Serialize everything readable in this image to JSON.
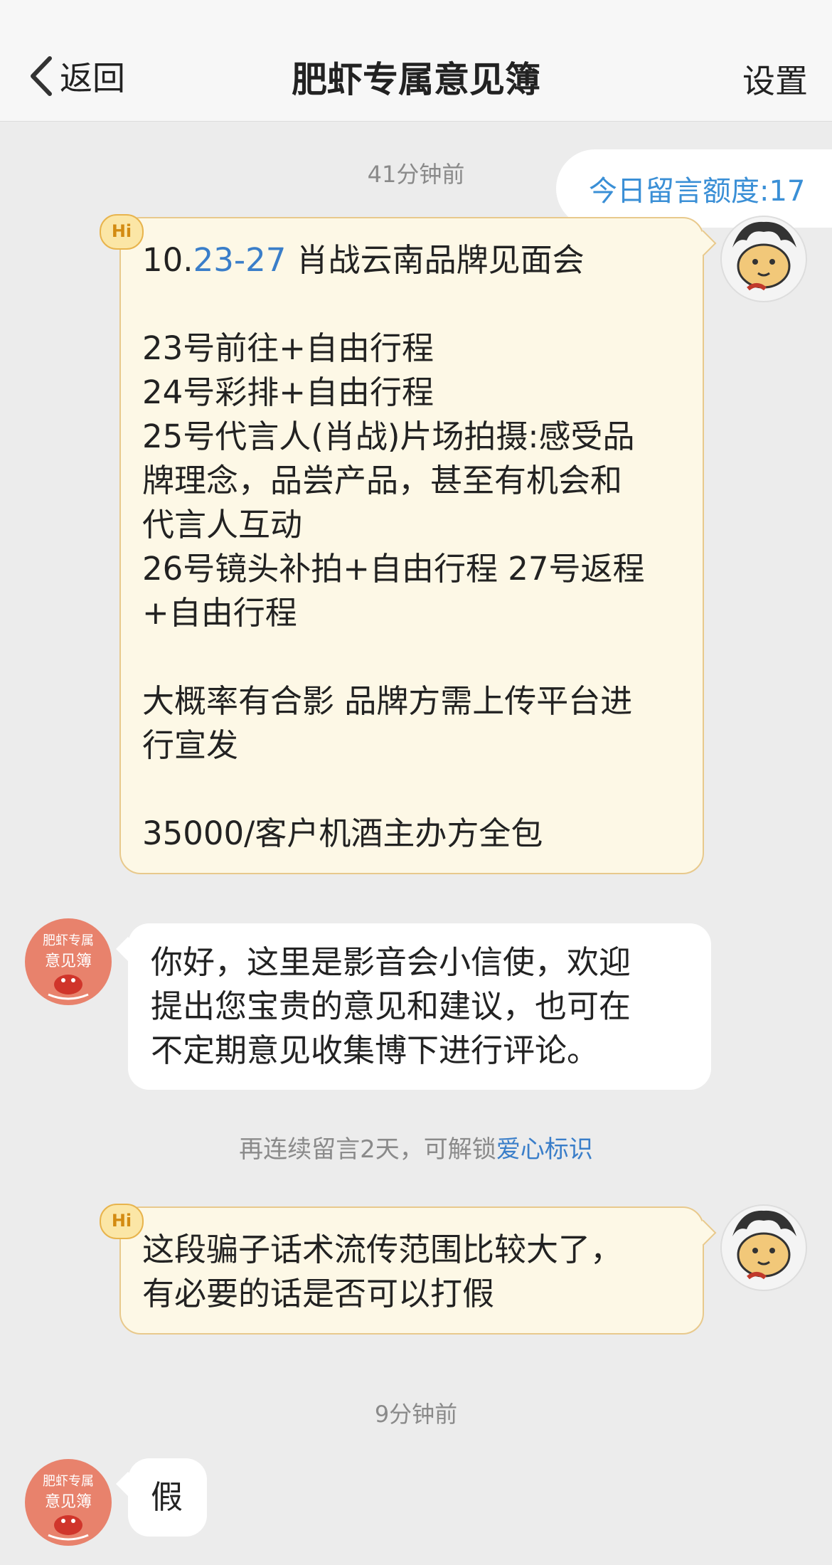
{
  "nav": {
    "back_label": "返回",
    "title": "肥虾专属意见簿",
    "settings_label": "设置"
  },
  "quota": {
    "label": "今日留言额度:17"
  },
  "timestamps": {
    "first": "41分钟前",
    "second": "9分钟前"
  },
  "messages": {
    "m1": {
      "badge": "Hi",
      "line1_prefix": "10.",
      "line1_highlight": "23-27",
      "line1_rest": " 肖战云南品牌见面会",
      "lines": [
        "23号前往+自由行程",
        "24号彩排+自由行程",
        "25号代言人(肖战)片场拍摄:感受品",
        "牌理念，品尝产品，甚至有机会和",
        "代言人互动",
        "26号镜头补拍+自由行程 27号返程",
        "+自由行程"
      ],
      "lines2": [
        "大概率有合影 品牌方需上传平台进",
        "行宣发"
      ],
      "price": "35000/客户机酒主办方全包"
    },
    "m2": {
      "lines": [
        "你好，这里是影音会小信使，欢迎",
        "提出您宝贵的意见和建议，也可在",
        "不定期意见收集博下进行评论。"
      ]
    },
    "m3": {
      "badge": "Hi",
      "lines": [
        "这段骗子话术流传范围比较大了，",
        "有必要的话是否可以打假"
      ]
    },
    "m4": {
      "text": "假"
    }
  },
  "notice": {
    "prefix": "再连续留言2天，可解锁",
    "link": "爱心标识"
  },
  "bot_avatar_text": [
    "肥虾专属",
    "意见簿"
  ],
  "colors": {
    "link_blue": "#3a7ec9",
    "mine_bubble": "#fdf8e6",
    "mine_border": "#e8c98c",
    "background": "#ececec"
  }
}
